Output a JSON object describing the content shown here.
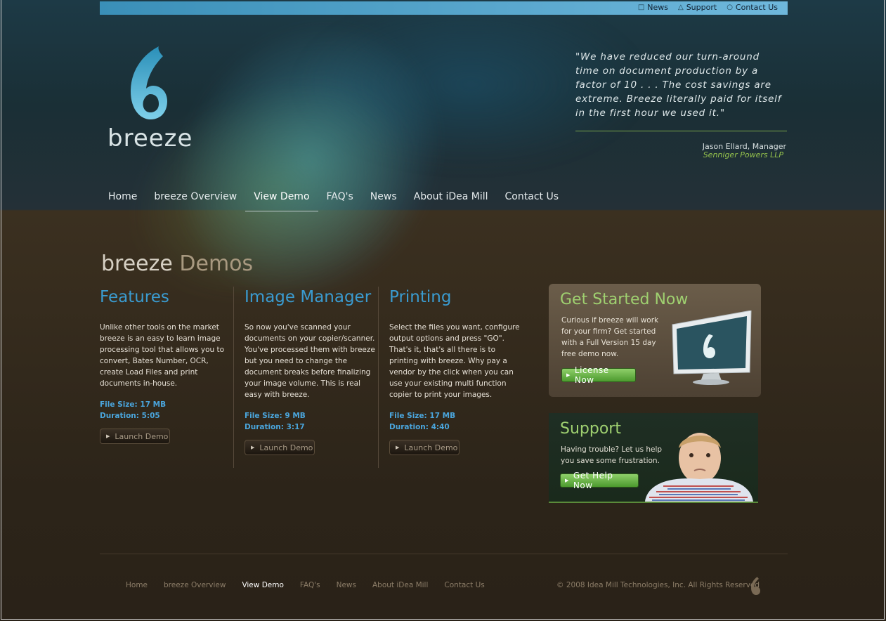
{
  "utility_links": [
    {
      "label": "News",
      "icon": "speech-bubble-icon"
    },
    {
      "label": "Support",
      "icon": "warning-triangle-icon"
    },
    {
      "label": "Contact Us",
      "icon": "person-icon"
    }
  ],
  "brand": {
    "name": "breeze"
  },
  "testimonial": {
    "quote": "\"We have reduced our turn-around time on document production by a factor of 10 . . . The cost savings are extreme. Breeze literally paid for itself in the first hour we used it.\"",
    "author": "Jason Ellard, Manager",
    "company": "Senniger Powers LLP"
  },
  "nav": [
    {
      "label": "Home"
    },
    {
      "label": "breeze Overview"
    },
    {
      "label": "View Demo",
      "active": true
    },
    {
      "label": "FAQ's"
    },
    {
      "label": "News"
    },
    {
      "label": "About iDea Mill"
    },
    {
      "label": "Contact Us"
    }
  ],
  "page_heading": {
    "brand": "breeze",
    "title": "Demos"
  },
  "demos": [
    {
      "title": "Features",
      "body": "Unlike other tools on the market breeze is an easy to learn image processing tool that allows you to convert, Bates Number, OCR, create Load Files and print documents in-house.",
      "file_size": "File Size: 17 MB",
      "duration": "Duration: 5:05",
      "button": "Launch Demo"
    },
    {
      "title": "Image Manager",
      "body": "So now you've scanned your documents on your copier/scanner. You've processed them with breeze but you need to change the document breaks before finalizing your image volume. This is real easy with breeze.",
      "file_size": "File Size: 9 MB",
      "duration": "Duration: 3:17",
      "button": "Launch Demo"
    },
    {
      "title": "Printing",
      "body": "Select the files you want, configure output options and press \"GO\". That's it, that's all there is to printing with breeze. Why pay a vendor by the click when you can use your existing multi function copier to print your images.",
      "file_size": "File Size: 17 MB",
      "duration": "Duration: 4:40",
      "button": "Launch Demo"
    }
  ],
  "get_started": {
    "title": "Get Started Now",
    "body": "Curious if breeze will work for your firm? Get started with a Full Version 15 day free demo now.",
    "button": "License Now"
  },
  "support": {
    "title": "Support",
    "body": "Having trouble? Let us help you save some frustration.",
    "button": "Get Help Now"
  },
  "footer": {
    "links": [
      {
        "label": "Home"
      },
      {
        "label": "breeze Overview"
      },
      {
        "label": "View Demo",
        "active": true
      },
      {
        "label": "FAQ's"
      },
      {
        "label": "News"
      },
      {
        "label": "About iDea Mill"
      },
      {
        "label": "Contact Us"
      }
    ],
    "copyright": "© 2008 Idea Mill Technologies, Inc. All Rights Reserved"
  },
  "colors": {
    "accent_blue": "#3a9bd0",
    "accent_green": "#9fd070",
    "brown_bg": "#2c2419",
    "teal_header": "#1d3a46"
  }
}
